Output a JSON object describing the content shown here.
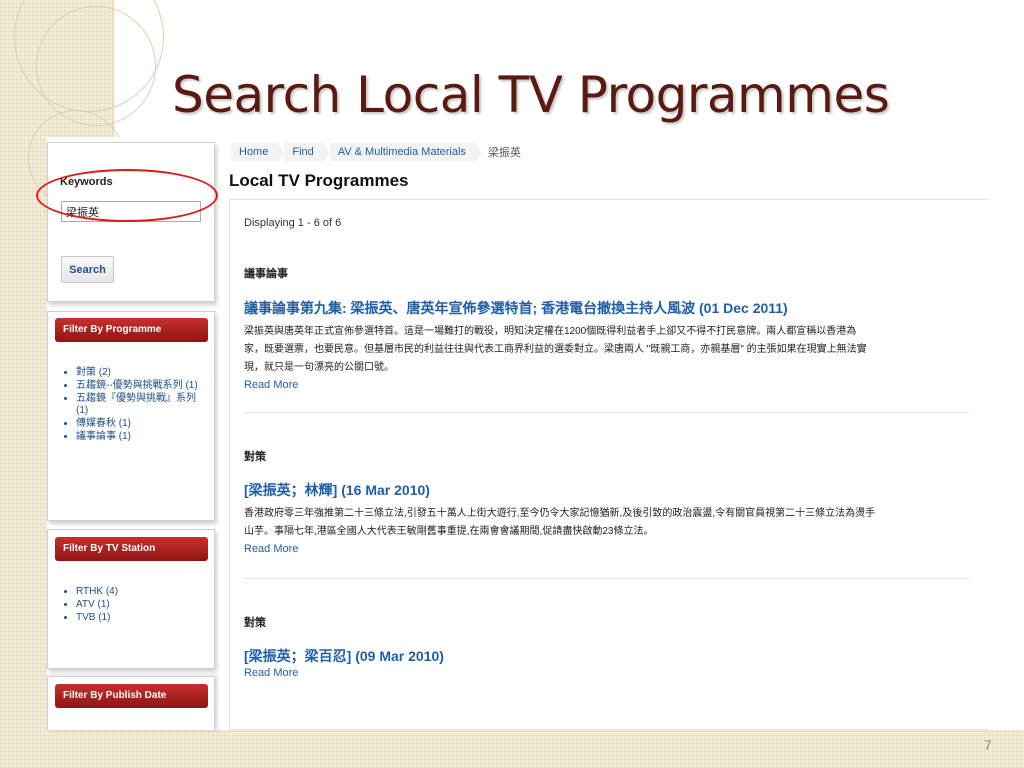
{
  "slide": {
    "title": "Search Local TV Programmes",
    "page_number": "7"
  },
  "sidebar": {
    "keywords_label": "Keywords",
    "keywords_value": "梁振英",
    "search_button": "Search",
    "filter_programme": {
      "header": "Filter By Programme",
      "items": [
        "對策 (2)",
        "五趨鏡--優勢與挑戰系列 (1)",
        "五趨鏡『優勢與挑戰』系列 (1)",
        "傳媒春秋 (1)",
        "議事論事 (1)"
      ]
    },
    "filter_station": {
      "header": "Filter By TV Station",
      "items": [
        "RTHK (4)",
        "ATV (1)",
        "TVB (1)"
      ]
    },
    "filter_date": {
      "header": "Filter By Publish Date"
    }
  },
  "breadcrumb": [
    "Home",
    "Find",
    "AV & Multimedia Materials",
    "梁振英"
  ],
  "main": {
    "heading": "Local TV Programmes",
    "displaying": "Displaying 1 - 6 of 6",
    "read_more": "Read More",
    "results": [
      {
        "category": "議事論事",
        "title": "議事論事第九集: 梁振英、唐英年宣佈參選特首; 香港電台撤換主持人風波 (01 Dec 2011)",
        "desc_lines": [
          "梁振英與唐英年正式宣佈參選特首。這是一場難打的戰役，明知決定權在1200個既得利益者手上卻又不得不打民意牌。兩人都宣稱以香港為",
          "家，既要選票，也要民意。但基層市民的利益往往與代表工商界利益的選委對立。梁唐兩人 \"既親工商，亦親基層\" 的主張如果在現實上無法實",
          "現，就只是一句漂亮的公關口號。"
        ]
      },
      {
        "category": "對策",
        "title": "[梁振英；林輝] (16 Mar 2010)",
        "desc_lines": [
          "香港政府零三年強推第二十三條立法,引發五十萬人上街大遊行,至今仍令大家記憶猶新,及後引致的政治震盪,令有關官員視第二十三條立法為燙手",
          "山芋。事隔七年,港區全國人大代表王敏剛舊事重提,在兩會會議期間,促請盡快啟動23條立法。"
        ]
      },
      {
        "category": "對策",
        "title": "[梁振英；梁百忍] (09 Mar 2010)",
        "desc_lines": []
      }
    ]
  }
}
